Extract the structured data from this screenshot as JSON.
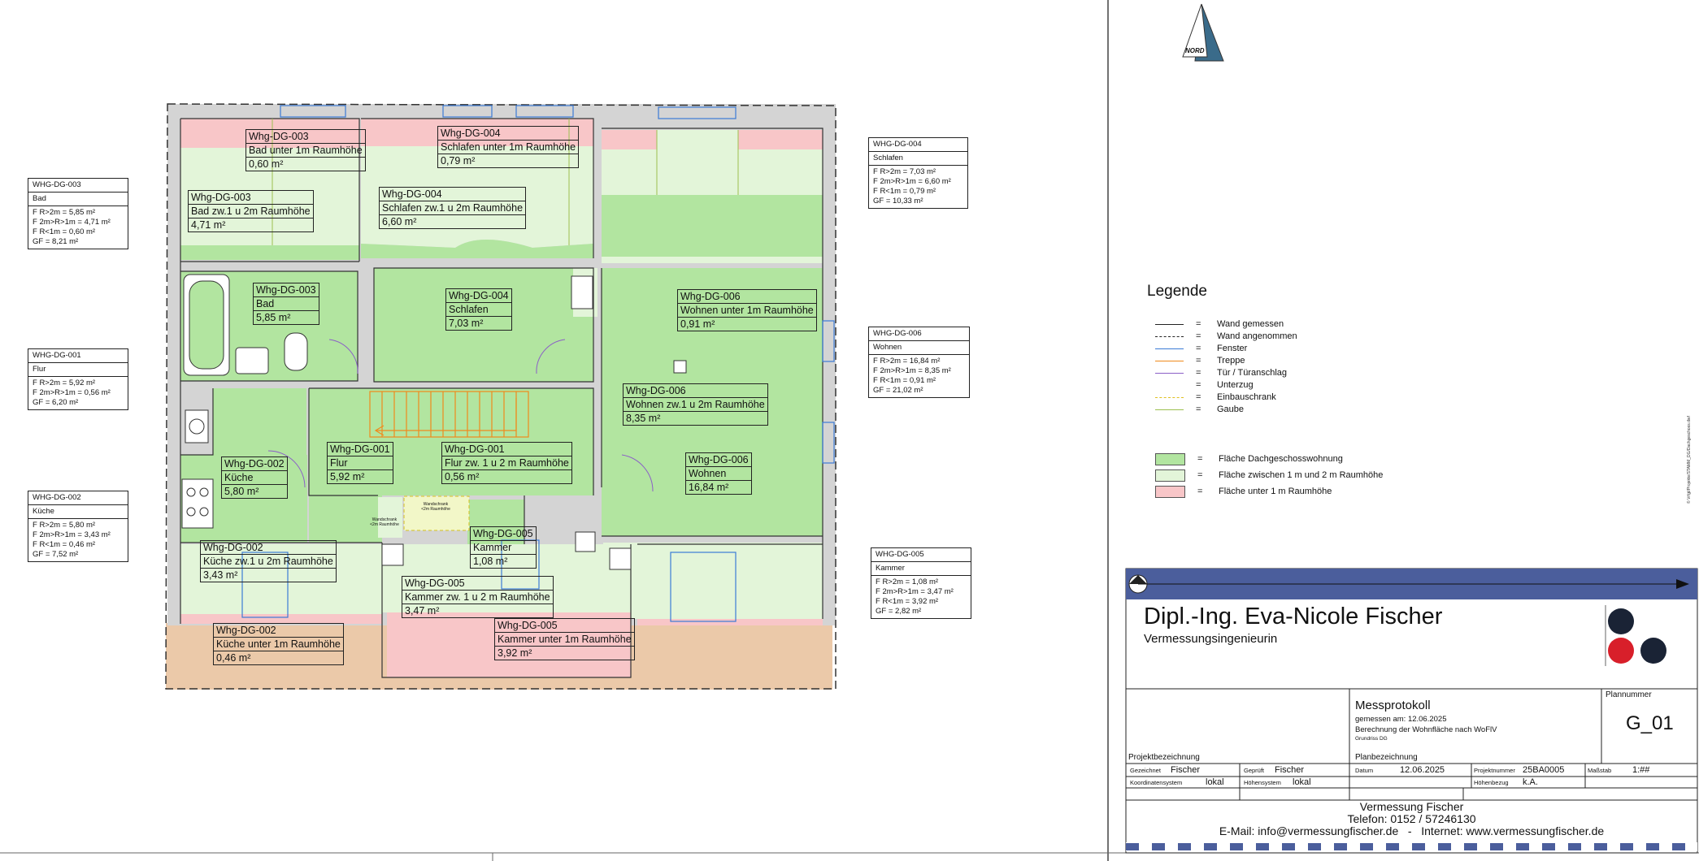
{
  "legend": {
    "title": "Legende",
    "lines": [
      {
        "text": "Wand gemessen",
        "color": "#222222",
        "style": "solid"
      },
      {
        "text": "Wand angenommen",
        "color": "#222222",
        "style": "dashed"
      },
      {
        "text": "Fenster",
        "color": "#3b7bd6",
        "style": "solid"
      },
      {
        "text": "Treppe",
        "color": "#f08a1c",
        "style": "solid"
      },
      {
        "text": "Tür / Türanschlag",
        "color": "#8b5fc7",
        "style": "solid"
      },
      {
        "text": "Unterzug",
        "color": "#ffffff",
        "style": "none"
      },
      {
        "text": "Einbauschrank",
        "color": "#e0c020",
        "style": "dashed"
      },
      {
        "text": "Gaube",
        "color": "#9cc050",
        "style": "solid"
      }
    ],
    "fills": [
      {
        "text": "Fläche Dachgeschosswohnung",
        "color": "#b2e5a0"
      },
      {
        "text": "Fläche zwischen 1 m und 2 m Raumhöhe",
        "color": "#e3f5d9"
      },
      {
        "text": "Fläche unter 1 m Raumhöhe",
        "color": "#f8c6c8"
      }
    ],
    "eq": "="
  },
  "compass": {
    "label": "NORD"
  },
  "colors": {
    "main": "#b2e5a0",
    "between": "#e3f5d9",
    "below": "#f8c6c8",
    "outside": "#ebc9a9",
    "wall": "#d4d4d4",
    "titlebar": "#4b5e9c"
  },
  "infoboxes": {
    "dg003": {
      "id": "WHG-DG-003",
      "name": "Bad",
      "lines": [
        "F R>2m = 5,85 m²",
        "F 2m>R>1m = 4,71 m²",
        "F R<1m = 0,60 m²",
        "GF = 8,21 m²"
      ]
    },
    "dg001": {
      "id": "WHG-DG-001",
      "name": "Flur",
      "lines": [
        "F R>2m = 5,92 m²",
        "F 2m>R>1m = 0,56 m²",
        "GF = 6,20 m²"
      ]
    },
    "dg002": {
      "id": "WHG-DG-002",
      "name": "Küche",
      "lines": [
        "F R>2m = 5,80 m²",
        "F 2m>R>1m = 3,43 m²",
        "F R<1m = 0,46 m²",
        "GF = 7,52 m²"
      ]
    },
    "dg004": {
      "id": "WHG-DG-004",
      "name": "Schlafen",
      "lines": [
        "F R>2m = 7,03 m²",
        "F 2m>R>1m = 6,60 m²",
        "F R<1m = 0,79 m²",
        "GF = 10,33 m²"
      ]
    },
    "dg006": {
      "id": "WHG-DG-006",
      "name": "Wohnen",
      "lines": [
        "F R>2m = 16,84 m²",
        "F 2m>R>1m = 8,35 m²",
        "F R<1m = 0,91 m²",
        "GF = 21,02 m²"
      ]
    },
    "dg005": {
      "id": "WHG-DG-005",
      "name": "Kammer",
      "lines": [
        "F R>2m = 1,08 m²",
        "F 2m>R>1m = 3,47 m²",
        "F R<1m = 3,92 m²",
        "GF = 2,82 m²"
      ]
    }
  },
  "labels": {
    "l1": {
      "id": "Whg-DG-003",
      "name": "Bad unter 1m Raumhöhe",
      "area": "0,60 m²"
    },
    "l2": {
      "id": "Whg-DG-004",
      "name": "Schlafen unter 1m Raumhöhe",
      "area": "0,79 m²"
    },
    "l3": {
      "id": "Whg-DG-003",
      "name": "Bad zw.1 u 2m Raumhöhe",
      "area": "4,71 m²"
    },
    "l4": {
      "id": "Whg-DG-004",
      "name": "Schlafen zw.1 u 2m Raumhöhe",
      "area": "6,60 m²"
    },
    "l5": {
      "id": "Whg-DG-003",
      "name": "Bad",
      "area": "5,85 m²"
    },
    "l6": {
      "id": "Whg-DG-004",
      "name": "Schlafen",
      "area": "7,03 m²"
    },
    "l7": {
      "id": "Whg-DG-006",
      "name": "Wohnen unter 1m Raumhöhe",
      "area": "0,91 m²"
    },
    "l8": {
      "id": "Whg-DG-006",
      "name": "Wohnen zw.1 u 2m Raumhöhe",
      "area": "8,35 m²"
    },
    "l9": {
      "id": "Whg-DG-001",
      "name": "Flur",
      "area": "5,92 m²"
    },
    "l10": {
      "id": "Whg-DG-001",
      "name": "Flur zw. 1 u 2 m Raumhöhe",
      "area": "0,56 m²"
    },
    "l11": {
      "id": "Whg-DG-002",
      "name": "Küche",
      "area": "5,80 m²"
    },
    "l12": {
      "id": "Whg-DG-006",
      "name": "Wohnen",
      "area": "16,84 m²"
    },
    "l13": {
      "id": "Whg-DG-005",
      "name": "Kammer",
      "area": "1,08 m²"
    },
    "l14": {
      "id": "Whg-DG-002",
      "name": "Küche zw.1 u 2m Raumhöhe",
      "area": "3,43 m²"
    },
    "l15": {
      "id": "Whg-DG-005",
      "name": "Kammer zw. 1 u 2 m Raumhöhe",
      "area": "3,47 m²"
    },
    "l16": {
      "id": "Whg-DG-005",
      "name": "Kammer unter 1m Raumhöhe",
      "area": "3,92 m²"
    },
    "l17": {
      "id": "Whg-DG-002",
      "name": "Küche unter 1m Raumhöhe",
      "area": "0,46 m²"
    }
  },
  "wardrobe": {
    "line1": "Wandschrank",
    "line2": "<2m Raumhöhe"
  },
  "titleblock": {
    "name": "Dipl.-Ing. Eva-Nicole Fischer",
    "profession": "Vermessungsingenieurin",
    "protocol": "Messprotokoll",
    "measured": "gemessen am: 12.06.2025",
    "calc": "Berechnung der Wohnfläche nach WoFlV",
    "plan_desc": "Grundriss DG",
    "plannummer_label": "Plannummer",
    "plannummer": "G_01",
    "projektbezeichnung": "Projektbezeichnung",
    "planbezeichnung": "Planbezeichnung",
    "gezeichnet_label": "Gezeichnet",
    "gezeichnet": "Fischer",
    "geprueft_label": "Geprüft",
    "geprueft": "Fischer",
    "datum_label": "Datum",
    "datum": "12.06.2025",
    "projektnummer_label": "Projektnummer",
    "projektnummer": "25BA0005",
    "massstab_label": "Maßstab",
    "massstab": "1:##",
    "koord_label": "Koordinatensystem",
    "koord": "lokal",
    "hoehensys_label": "Höhensystem",
    "hoehensys": "lokal",
    "hoehenbezug_label": "Höhenbezug",
    "hoehenbezug": "k.A.",
    "company": "Vermessung Fischer",
    "phone": "Telefon: 0152 / 57246130",
    "contact": "E-Mail: info@vermessungfischer.de   -   Internet: www.vermessungfischer.de",
    "side_note": "© Vrfgt/Projekte/STAMM_DG/Dachgeschoss.dwf"
  }
}
